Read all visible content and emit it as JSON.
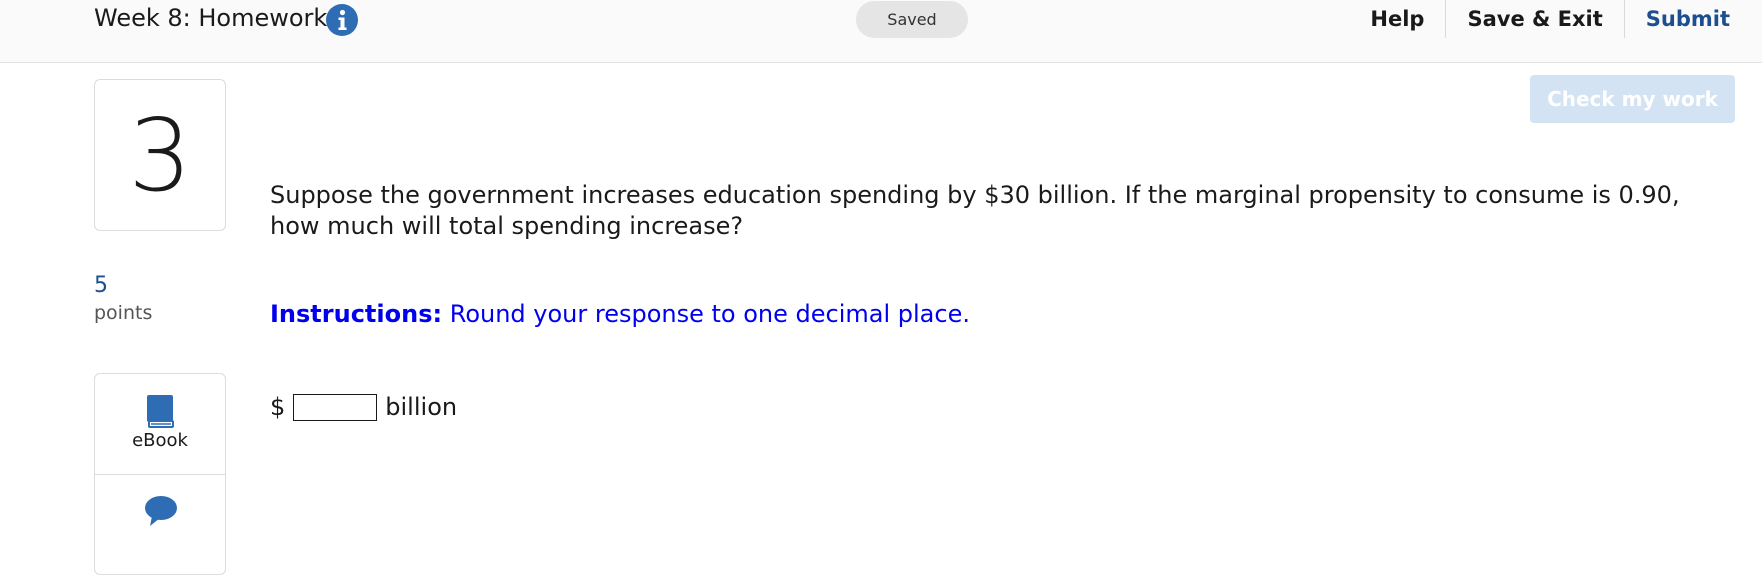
{
  "header": {
    "assignment_title": "Week 8: Homework",
    "info_icon": "info-circle-icon",
    "saved_label": "Saved",
    "links": {
      "help": "Help",
      "save_exit": "Save & Exit",
      "submit": "Submit"
    }
  },
  "question": {
    "number": "3",
    "points_value": "5",
    "points_label": "points",
    "check_button_label": "Check my work",
    "text": "Suppose the government increases education spending by $30 billion. If the marginal propensity to consume is 0.90, how much will total spending increase?",
    "instructions_label": "Instructions:",
    "instructions_text": "Round your response to one decimal place.",
    "answer": {
      "prefix": "$",
      "value": "",
      "suffix": "billion"
    }
  },
  "tools": {
    "ebook_label": "eBook",
    "ebook_icon": "book-icon",
    "chat_icon": "chat-bubble-icon"
  },
  "colors": {
    "accent": "#1b4f8f",
    "info_icon": "#2e6db4",
    "instructions": "#0000ee",
    "check_button_disabled": "#d4e3f3"
  }
}
